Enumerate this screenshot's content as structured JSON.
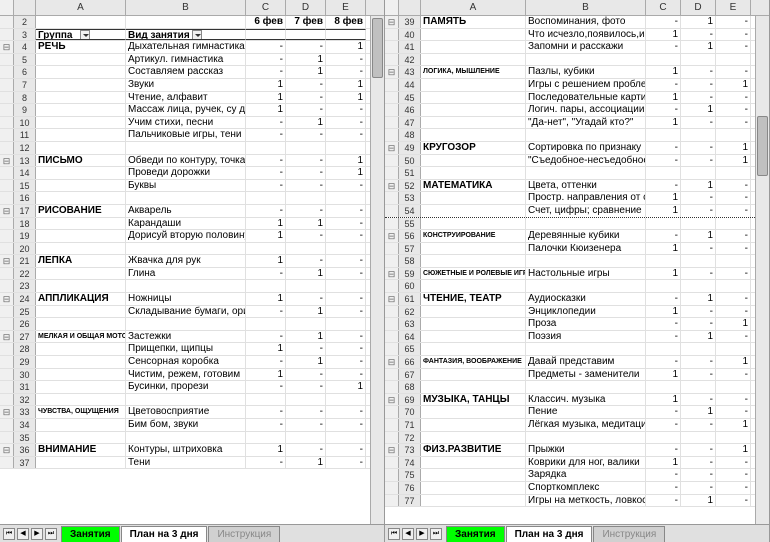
{
  "tabs": {
    "t1": "Занятия",
    "t2": "План на 3 дня",
    "t3": "Инструкция"
  },
  "col_labels": [
    "A",
    "B",
    "C",
    "D",
    "E"
  ],
  "header": {
    "group": "Группа_",
    "activity": "Вид занятия",
    "d1": "6 фев",
    "d2": "7 фев",
    "d3": "8 фев"
  },
  "left_rows": [
    {
      "n": 2,
      "d1": "6 фев",
      "d2": "7 фев",
      "d3": "8 фев"
    },
    {
      "n": 3,
      "header": true
    },
    {
      "n": 4,
      "out": "-",
      "a": "РЕЧЬ",
      "b": "Дыхательная гимнастика",
      "c": "-",
      "d": "-",
      "e": "1"
    },
    {
      "n": 5,
      "b": "Артикул. гимнастика",
      "c": "-",
      "d": "1",
      "e": "-"
    },
    {
      "n": 6,
      "b": "Составляем рассказ",
      "c": "-",
      "d": "1",
      "e": "-"
    },
    {
      "n": 7,
      "b": "Звуки",
      "c": "1",
      "d": "-",
      "e": "1"
    },
    {
      "n": 8,
      "b": "Чтение, алфавит",
      "c": "1",
      "d": "-",
      "e": "1"
    },
    {
      "n": 9,
      "b": "Массаж лица, ручек, су дж",
      "c": "1",
      "d": "-",
      "e": "-"
    },
    {
      "n": 10,
      "b": "Учим стихи, песни",
      "c": "-",
      "d": "1",
      "e": "-"
    },
    {
      "n": 11,
      "b": "Пальчиковые игры, тени",
      "c": "-",
      "d": "-",
      "e": "-"
    },
    {
      "n": 12,
      "blank": true
    },
    {
      "n": 13,
      "out": "-",
      "a": "ПИСЬМО",
      "b": "Обведи по контуру, точкам",
      "c": "-",
      "d": "-",
      "e": "1"
    },
    {
      "n": 14,
      "b": "Проведи дорожки",
      "c": "-",
      "d": "-",
      "e": "1"
    },
    {
      "n": 15,
      "b": "Буквы",
      "c": "-",
      "d": "-",
      "e": "-"
    },
    {
      "n": 16,
      "blank": true
    },
    {
      "n": 17,
      "out": "-",
      "a": "РИСОВАНИЕ",
      "b": "Акварель",
      "c": "-",
      "d": "-",
      "e": "-"
    },
    {
      "n": 18,
      "b": "Карандаши",
      "c": "1",
      "d": "1",
      "e": "-"
    },
    {
      "n": 19,
      "b": "Дорисуй вторую половину",
      "c": "1",
      "d": "-",
      "e": "-"
    },
    {
      "n": 20,
      "blank": true
    },
    {
      "n": 21,
      "out": "-",
      "a": "ЛЕПКА",
      "b": "Жвачка для рук",
      "c": "1",
      "d": "-",
      "e": "-"
    },
    {
      "n": 22,
      "b": "Глина",
      "c": "-",
      "d": "1",
      "e": "-"
    },
    {
      "n": 23,
      "blank": true
    },
    {
      "n": 24,
      "out": "-",
      "a": "АППЛИКАЦИЯ",
      "b": "Ножницы",
      "c": "1",
      "d": "-",
      "e": "-"
    },
    {
      "n": 25,
      "b": "Складывание бумаги, ори",
      "c": "-",
      "d": "1",
      "e": "-"
    },
    {
      "n": 26,
      "blank": true
    },
    {
      "n": 27,
      "out": "-",
      "a": "МЕЛКАЯ И ОБЩАЯ МОТОРИКА",
      "small": true,
      "b": "Застежки",
      "c": "-",
      "d": "1",
      "e": "-"
    },
    {
      "n": 28,
      "b": "Прищепки, щипцы",
      "c": "1",
      "d": "-",
      "e": "-"
    },
    {
      "n": 29,
      "b": "Сенсорная коробка",
      "c": "-",
      "d": "1",
      "e": "-"
    },
    {
      "n": 30,
      "b": "Чистим, режем, готовим",
      "c": "1",
      "d": "-",
      "e": "-"
    },
    {
      "n": 31,
      "b": "Бусинки, прорези",
      "c": "-",
      "d": "-",
      "e": "1"
    },
    {
      "n": 32,
      "blank": true
    },
    {
      "n": 33,
      "out": "-",
      "a": "ЧУВСТВА, ОЩУЩЕНИЯ",
      "small": true,
      "b": "Цветовосприятие",
      "c": "-",
      "d": "-",
      "e": "-"
    },
    {
      "n": 34,
      "b": "Бим бом, звуки",
      "c": "-",
      "d": "-",
      "e": "-"
    },
    {
      "n": 35,
      "blank": true
    },
    {
      "n": 36,
      "out": "-",
      "a": "ВНИМАНИЕ",
      "b": "Контуры, штриховка",
      "c": "1",
      "d": "-",
      "e": "-"
    },
    {
      "n": 37,
      "b": "Тени",
      "c": "-",
      "d": "1",
      "e": "-"
    }
  ],
  "right_rows": [
    {
      "n": 39,
      "out": "-",
      "a": "ПАМЯТЬ",
      "b": "Воспоминания, фото",
      "c": "-",
      "d": "1",
      "e": "-"
    },
    {
      "n": 40,
      "b": "Что исчезло,появилось,из",
      "c": "1",
      "d": "-",
      "e": "-"
    },
    {
      "n": 41,
      "b": "Запомни и расскажи",
      "c": "-",
      "d": "1",
      "e": "-"
    },
    {
      "n": 42,
      "blank": true
    },
    {
      "n": 43,
      "out": "-",
      "a": "ЛОГИКА, МЫШЛЕНИЕ",
      "small": true,
      "b": "Пазлы, кубики",
      "c": "1",
      "d": "-",
      "e": "-"
    },
    {
      "n": 44,
      "b": "Игры с решением пробле",
      "c": "-",
      "d": "-",
      "e": "1"
    },
    {
      "n": 45,
      "b": "Последовательные карти",
      "c": "1",
      "d": "-",
      "e": "-"
    },
    {
      "n": 46,
      "b": "Логич. пары, ассоциации",
      "c": "-",
      "d": "1",
      "e": "-"
    },
    {
      "n": 47,
      "b": "\"Да-нет\", \"Угадай кто?\"",
      "c": "1",
      "d": "-",
      "e": "-"
    },
    {
      "n": 48,
      "blank": true
    },
    {
      "n": 49,
      "out": "-",
      "a": "КРУГОЗОР",
      "b": "Сортировка по признаку",
      "c": "-",
      "d": "-",
      "e": "1"
    },
    {
      "n": 50,
      "b": "\"Съедобное-несъедобное",
      "c": "-",
      "d": "-",
      "e": "1"
    },
    {
      "n": 51,
      "blank": true
    },
    {
      "n": 52,
      "out": "-",
      "a": "МАТЕМАТИКА",
      "b": "Цвета, оттенки",
      "c": "-",
      "d": "1",
      "e": "-"
    },
    {
      "n": 53,
      "b": "Простр. направления от с",
      "c": "1",
      "d": "-",
      "e": "-"
    },
    {
      "n": 54,
      "b": "Счет, цифры; сравнение",
      "c": "1",
      "d": "-",
      "e": "-",
      "dotted": true
    },
    {
      "n": 55,
      "blank": true
    },
    {
      "n": 56,
      "out": "-",
      "a": "КОНСТРУИРОВАНИЕ",
      "small": true,
      "b": "Деревянные кубики",
      "c": "-",
      "d": "1",
      "e": "-"
    },
    {
      "n": 57,
      "b": "Палочки Кюизенера",
      "c": "1",
      "d": "-",
      "e": "-"
    },
    {
      "n": 58,
      "blank": true
    },
    {
      "n": 59,
      "out": "-",
      "a": "СЮЖЕТНЫЕ И РОЛЕВЫЕ ИГРЫ",
      "small": true,
      "b": "Настольные игры",
      "c": "1",
      "d": "-",
      "e": "-"
    },
    {
      "n": 60,
      "blank": true
    },
    {
      "n": 61,
      "out": "-",
      "a": "ЧТЕНИЕ, ТЕАТР",
      "b": "Аудиосказки",
      "c": "-",
      "d": "1",
      "e": "-"
    },
    {
      "n": 62,
      "b": "Энциклопедии",
      "c": "1",
      "d": "-",
      "e": "-"
    },
    {
      "n": 63,
      "b": "Проза",
      "c": "-",
      "d": "-",
      "e": "1"
    },
    {
      "n": 64,
      "b": "Поэзия",
      "c": "-",
      "d": "1",
      "e": "-"
    },
    {
      "n": 65,
      "blank": true
    },
    {
      "n": 66,
      "out": "-",
      "a": "ФАНТАЗИЯ, ВООБРАЖЕНИЕ",
      "small": true,
      "b": "Давай представим",
      "c": "-",
      "d": "-",
      "e": "1"
    },
    {
      "n": 67,
      "b": "Предметы - заменители",
      "c": "1",
      "d": "-",
      "e": "-"
    },
    {
      "n": 68,
      "blank": true
    },
    {
      "n": 69,
      "out": "-",
      "a": "МУЗЫКА, ТАНЦЫ",
      "b": "Классич. музыка",
      "c": "1",
      "d": "-",
      "e": "-"
    },
    {
      "n": 70,
      "b": "Пение",
      "c": "-",
      "d": "1",
      "e": "-"
    },
    {
      "n": 71,
      "b": "Лёгкая музыка, медитаци",
      "c": "-",
      "d": "-",
      "e": "1"
    },
    {
      "n": 72,
      "blank": true
    },
    {
      "n": 73,
      "out": "-",
      "a": "ФИЗ.РАЗВИТИЕ",
      "b": "Прыжки",
      "c": "-",
      "d": "-",
      "e": "1"
    },
    {
      "n": 74,
      "b": "Коврики для ног, валики",
      "c": "1",
      "d": "-",
      "e": "-"
    },
    {
      "n": 75,
      "b": "Зарядка",
      "c": "-",
      "d": "-",
      "e": "-"
    },
    {
      "n": 76,
      "b": "Спорткомплекс",
      "c": "-",
      "d": "-",
      "e": "-"
    },
    {
      "n": 77,
      "b": "Игры на меткость, ловкос",
      "c": "-",
      "d": "1",
      "e": "-"
    }
  ]
}
